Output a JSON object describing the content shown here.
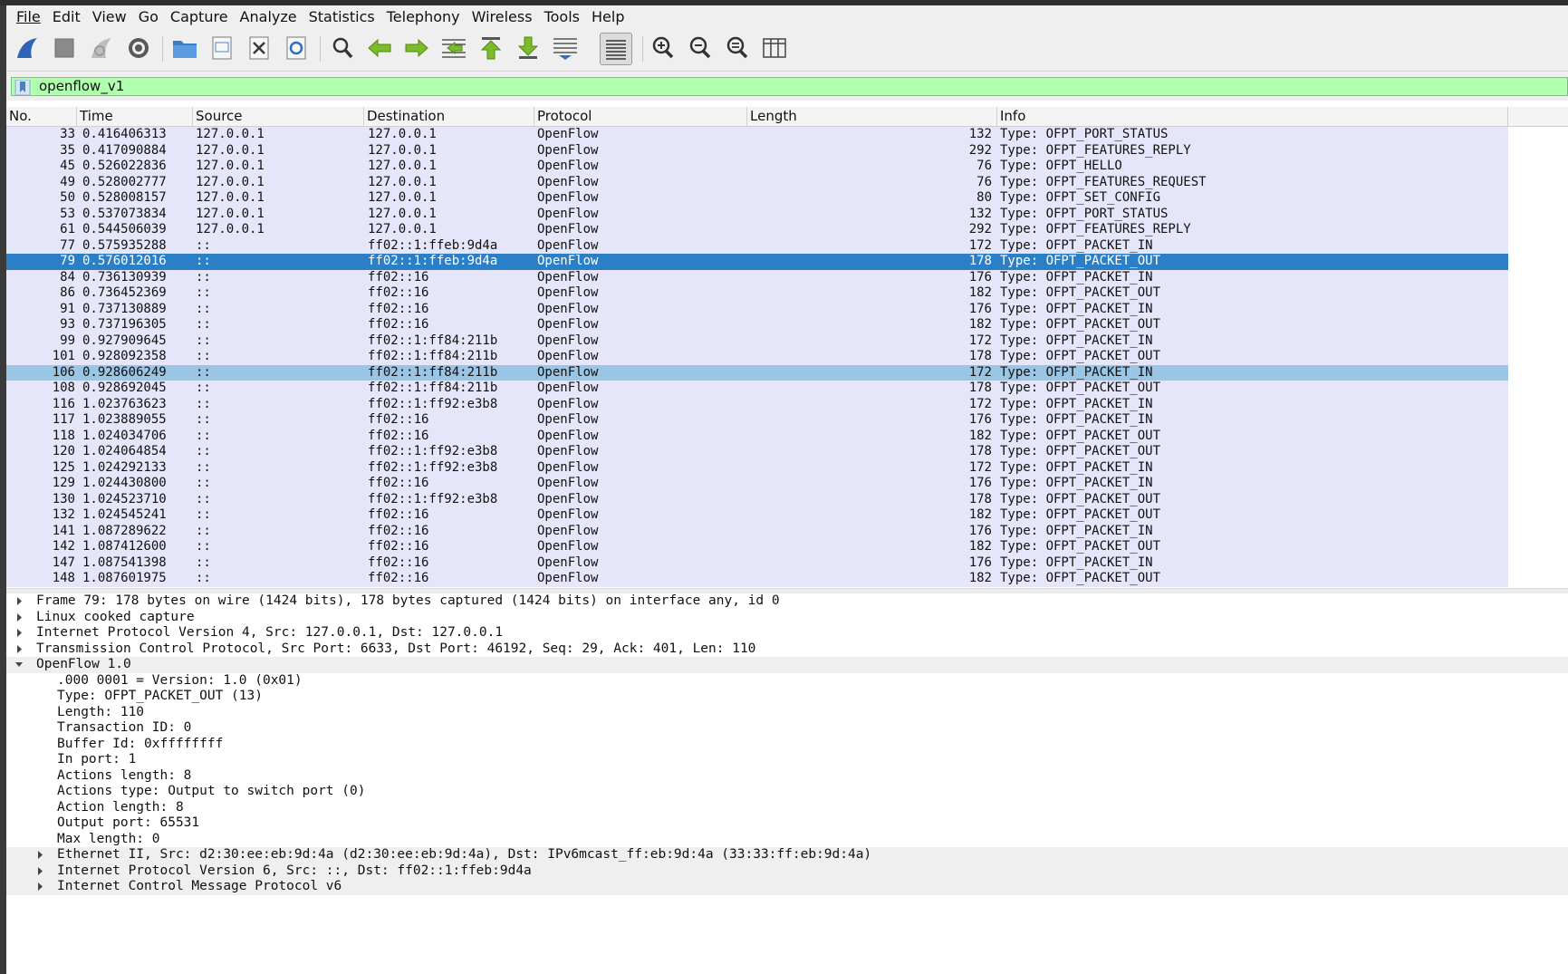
{
  "menu": [
    "File",
    "Edit",
    "View",
    "Go",
    "Capture",
    "Analyze",
    "Statistics",
    "Telephony",
    "Wireless",
    "Tools",
    "Help"
  ],
  "toolbar_icons": [
    "shark-fin-start-icon",
    "stop-square-icon",
    "restart-fin-icon",
    "capture-options-gear-icon",
    "open-folder-icon",
    "save-file-icon",
    "close-file-icon",
    "reload-file-icon",
    "find-magnifier-icon",
    "go-back-arrow-icon",
    "go-forward-arrow-icon",
    "go-to-packet-icon",
    "first-packet-icon",
    "last-packet-icon",
    "autoscroll-icon",
    "colorize-icon",
    "zoom-in-icon",
    "zoom-out-icon",
    "zoom-normal-icon",
    "resize-columns-icon"
  ],
  "filter": {
    "value": "openflow_v1",
    "bg": "#afffaf"
  },
  "columns": {
    "no": "No.",
    "time": "Time",
    "source": "Source",
    "destination": "Destination",
    "protocol": "Protocol",
    "length": "Length",
    "info": "Info"
  },
  "packets": [
    {
      "no": "33",
      "time": "0.416406313",
      "src": "127.0.0.1",
      "dst": "127.0.0.1",
      "proto": "OpenFlow",
      "len": "132",
      "info": "Type: OFPT_PORT_STATUS"
    },
    {
      "no": "35",
      "time": "0.417090884",
      "src": "127.0.0.1",
      "dst": "127.0.0.1",
      "proto": "OpenFlow",
      "len": "292",
      "info": "Type: OFPT_FEATURES_REPLY"
    },
    {
      "no": "45",
      "time": "0.526022836",
      "src": "127.0.0.1",
      "dst": "127.0.0.1",
      "proto": "OpenFlow",
      "len": "76",
      "info": "Type: OFPT_HELLO"
    },
    {
      "no": "49",
      "time": "0.528002777",
      "src": "127.0.0.1",
      "dst": "127.0.0.1",
      "proto": "OpenFlow",
      "len": "76",
      "info": "Type: OFPT_FEATURES_REQUEST"
    },
    {
      "no": "50",
      "time": "0.528008157",
      "src": "127.0.0.1",
      "dst": "127.0.0.1",
      "proto": "OpenFlow",
      "len": "80",
      "info": "Type: OFPT_SET_CONFIG"
    },
    {
      "no": "53",
      "time": "0.537073834",
      "src": "127.0.0.1",
      "dst": "127.0.0.1",
      "proto": "OpenFlow",
      "len": "132",
      "info": "Type: OFPT_PORT_STATUS"
    },
    {
      "no": "61",
      "time": "0.544506039",
      "src": "127.0.0.1",
      "dst": "127.0.0.1",
      "proto": "OpenFlow",
      "len": "292",
      "info": "Type: OFPT_FEATURES_REPLY"
    },
    {
      "no": "77",
      "time": "0.575935288",
      "src": "::",
      "dst": "ff02::1:ffeb:9d4a",
      "proto": "OpenFlow",
      "len": "172",
      "info": "Type: OFPT_PACKET_IN"
    },
    {
      "no": "79",
      "time": "0.576012016",
      "src": "::",
      "dst": "ff02::1:ffeb:9d4a",
      "proto": "OpenFlow",
      "len": "178",
      "info": "Type: OFPT_PACKET_OUT",
      "state": "selected"
    },
    {
      "no": "84",
      "time": "0.736130939",
      "src": "::",
      "dst": "ff02::16",
      "proto": "OpenFlow",
      "len": "176",
      "info": "Type: OFPT_PACKET_IN"
    },
    {
      "no": "86",
      "time": "0.736452369",
      "src": "::",
      "dst": "ff02::16",
      "proto": "OpenFlow",
      "len": "182",
      "info": "Type: OFPT_PACKET_OUT"
    },
    {
      "no": "91",
      "time": "0.737130889",
      "src": "::",
      "dst": "ff02::16",
      "proto": "OpenFlow",
      "len": "176",
      "info": "Type: OFPT_PACKET_IN"
    },
    {
      "no": "93",
      "time": "0.737196305",
      "src": "::",
      "dst": "ff02::16",
      "proto": "OpenFlow",
      "len": "182",
      "info": "Type: OFPT_PACKET_OUT"
    },
    {
      "no": "99",
      "time": "0.927909645",
      "src": "::",
      "dst": "ff02::1:ff84:211b",
      "proto": "OpenFlow",
      "len": "172",
      "info": "Type: OFPT_PACKET_IN"
    },
    {
      "no": "101",
      "time": "0.928092358",
      "src": "::",
      "dst": "ff02::1:ff84:211b",
      "proto": "OpenFlow",
      "len": "178",
      "info": "Type: OFPT_PACKET_OUT"
    },
    {
      "no": "106",
      "time": "0.928606249",
      "src": "::",
      "dst": "ff02::1:ff84:211b",
      "proto": "OpenFlow",
      "len": "172",
      "info": "Type: OFPT_PACKET_IN",
      "state": "related"
    },
    {
      "no": "108",
      "time": "0.928692045",
      "src": "::",
      "dst": "ff02::1:ff84:211b",
      "proto": "OpenFlow",
      "len": "178",
      "info": "Type: OFPT_PACKET_OUT"
    },
    {
      "no": "116",
      "time": "1.023763623",
      "src": "::",
      "dst": "ff02::1:ff92:e3b8",
      "proto": "OpenFlow",
      "len": "172",
      "info": "Type: OFPT_PACKET_IN"
    },
    {
      "no": "117",
      "time": "1.023889055",
      "src": "::",
      "dst": "ff02::16",
      "proto": "OpenFlow",
      "len": "176",
      "info": "Type: OFPT_PACKET_IN"
    },
    {
      "no": "118",
      "time": "1.024034706",
      "src": "::",
      "dst": "ff02::16",
      "proto": "OpenFlow",
      "len": "182",
      "info": "Type: OFPT_PACKET_OUT"
    },
    {
      "no": "120",
      "time": "1.024064854",
      "src": "::",
      "dst": "ff02::1:ff92:e3b8",
      "proto": "OpenFlow",
      "len": "178",
      "info": "Type: OFPT_PACKET_OUT"
    },
    {
      "no": "125",
      "time": "1.024292133",
      "src": "::",
      "dst": "ff02::1:ff92:e3b8",
      "proto": "OpenFlow",
      "len": "172",
      "info": "Type: OFPT_PACKET_IN"
    },
    {
      "no": "129",
      "time": "1.024430800",
      "src": "::",
      "dst": "ff02::16",
      "proto": "OpenFlow",
      "len": "176",
      "info": "Type: OFPT_PACKET_IN"
    },
    {
      "no": "130",
      "time": "1.024523710",
      "src": "::",
      "dst": "ff02::1:ff92:e3b8",
      "proto": "OpenFlow",
      "len": "178",
      "info": "Type: OFPT_PACKET_OUT"
    },
    {
      "no": "132",
      "time": "1.024545241",
      "src": "::",
      "dst": "ff02::16",
      "proto": "OpenFlow",
      "len": "182",
      "info": "Type: OFPT_PACKET_OUT"
    },
    {
      "no": "141",
      "time": "1.087289622",
      "src": "::",
      "dst": "ff02::16",
      "proto": "OpenFlow",
      "len": "176",
      "info": "Type: OFPT_PACKET_IN"
    },
    {
      "no": "142",
      "time": "1.087412600",
      "src": "::",
      "dst": "ff02::16",
      "proto": "OpenFlow",
      "len": "182",
      "info": "Type: OFPT_PACKET_OUT"
    },
    {
      "no": "147",
      "time": "1.087541398",
      "src": "::",
      "dst": "ff02::16",
      "proto": "OpenFlow",
      "len": "176",
      "info": "Type: OFPT_PACKET_IN"
    },
    {
      "no": "148",
      "time": "1.087601975",
      "src": "::",
      "dst": "ff02::16",
      "proto": "OpenFlow",
      "len": "182",
      "info": "Type: OFPT_PACKET_OUT"
    }
  ],
  "details": [
    {
      "text": "Frame 79: 178 bytes on wire (1424 bits), 178 bytes captured (1424 bits) on interface any, id 0",
      "level": 0,
      "expander": "collapsed"
    },
    {
      "text": "Linux cooked capture",
      "level": 0,
      "expander": "collapsed"
    },
    {
      "text": "Internet Protocol Version 4, Src: 127.0.0.1, Dst: 127.0.0.1",
      "level": 0,
      "expander": "collapsed"
    },
    {
      "text": "Transmission Control Protocol, Src Port: 6633, Dst Port: 46192, Seq: 29, Ack: 401, Len: 110",
      "level": 0,
      "expander": "collapsed"
    },
    {
      "text": "OpenFlow 1.0",
      "level": 0,
      "expander": "expanded"
    },
    {
      "text": ".000 0001 = Version: 1.0 (0x01)",
      "level": 1,
      "expander": "none"
    },
    {
      "text": "Type: OFPT_PACKET_OUT (13)",
      "level": 1,
      "expander": "none"
    },
    {
      "text": "Length: 110",
      "level": 1,
      "expander": "none"
    },
    {
      "text": "Transaction ID: 0",
      "level": 1,
      "expander": "none"
    },
    {
      "text": "Buffer Id: 0xffffffff",
      "level": 1,
      "expander": "none"
    },
    {
      "text": "In port: 1",
      "level": 1,
      "expander": "none"
    },
    {
      "text": "Actions length: 8",
      "level": 1,
      "expander": "none"
    },
    {
      "text": "Actions type: Output to switch port (0)",
      "level": 1,
      "expander": "none"
    },
    {
      "text": "Action length: 8",
      "level": 1,
      "expander": "none"
    },
    {
      "text": "Output port: 65531",
      "level": 1,
      "expander": "none"
    },
    {
      "text": "Max length: 0",
      "level": 1,
      "expander": "none"
    },
    {
      "text": "Ethernet II, Src: d2:30:ee:eb:9d:4a (d2:30:ee:eb:9d:4a), Dst: IPv6mcast_ff:eb:9d:4a (33:33:ff:eb:9d:4a)",
      "level": 1,
      "expander": "collapsed",
      "shade": true
    },
    {
      "text": "Internet Protocol Version 6, Src: ::, Dst: ff02::1:ffeb:9d4a",
      "level": 1,
      "expander": "collapsed",
      "shade": true
    },
    {
      "text": "Internet Control Message Protocol v6",
      "level": 1,
      "expander": "collapsed",
      "shade": true
    }
  ],
  "colors": {
    "row_bg": "#e6e6fb",
    "selected": "#2a7fc6",
    "related": "#9bc5e4"
  }
}
